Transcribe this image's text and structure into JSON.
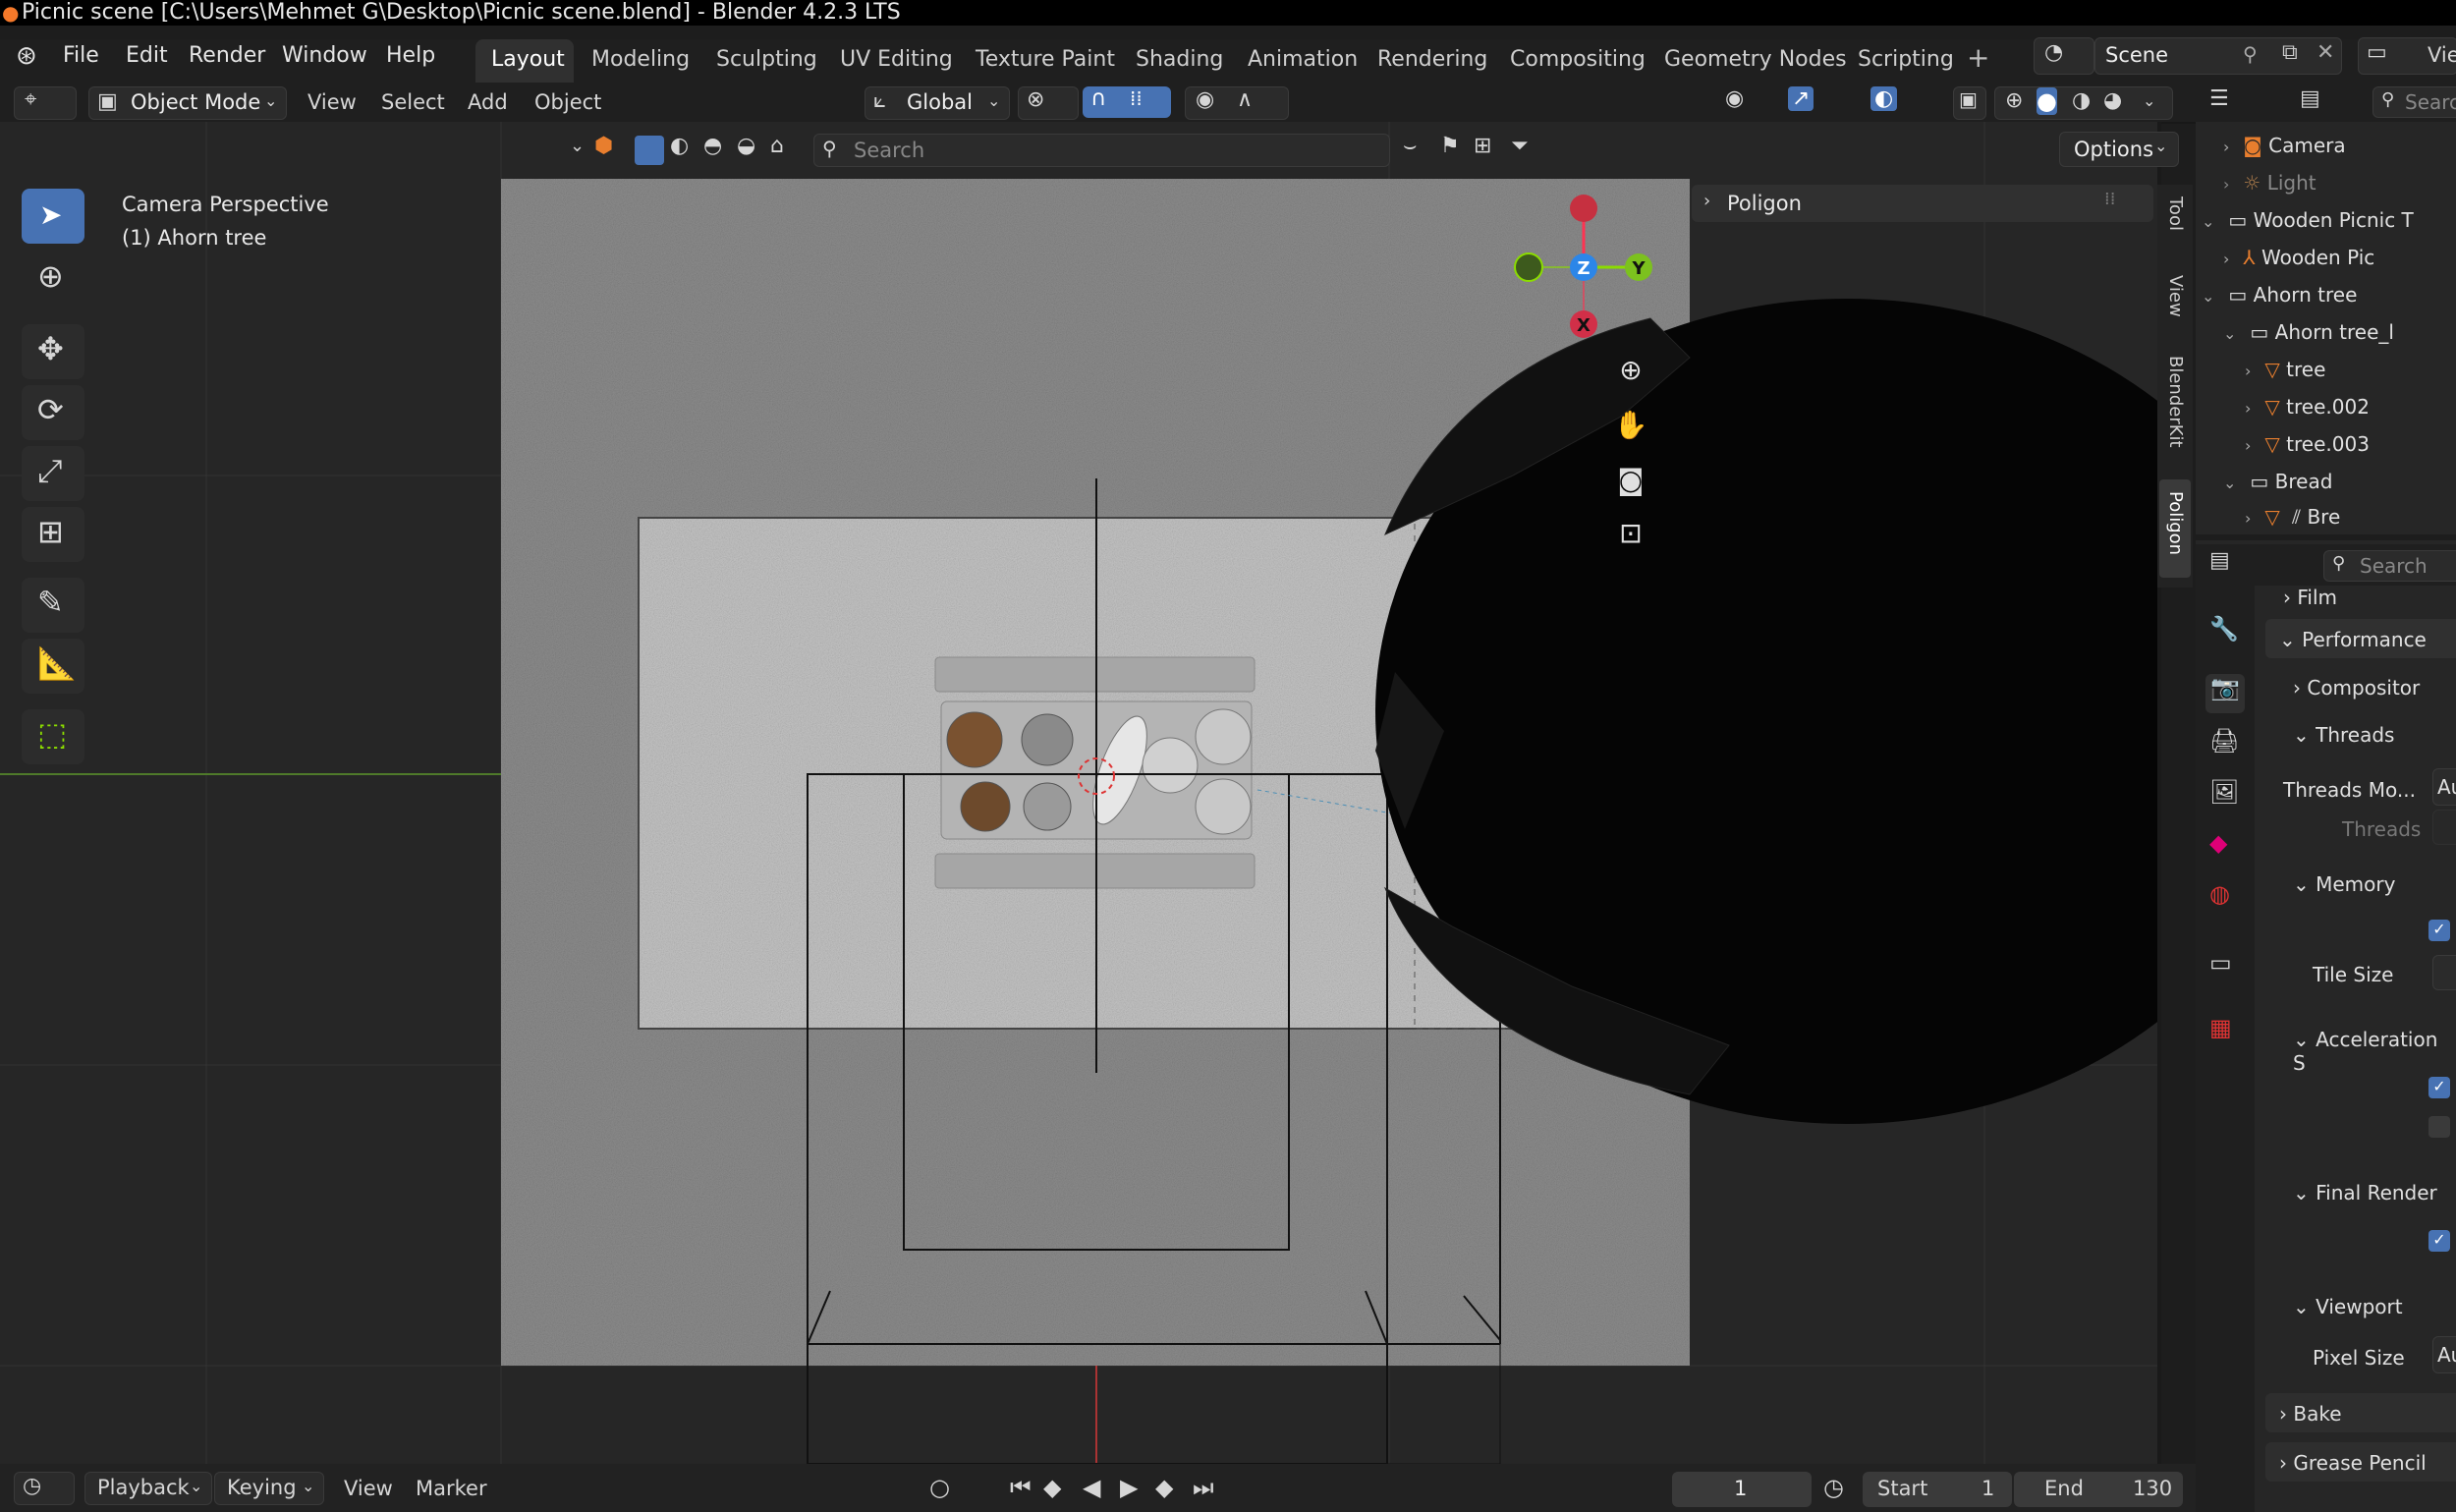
{
  "titlebar": {
    "text": "Picnic scene [C:\\Users\\Mehmet G\\Desktop\\Picnic scene.blend] - Blender 4.2.3 LTS"
  },
  "menu": {
    "file": "File",
    "edit": "Edit",
    "render": "Render",
    "window": "Window",
    "help": "Help"
  },
  "workspaces": [
    "Layout",
    "Modeling",
    "Sculpting",
    "UV Editing",
    "Texture Paint",
    "Shading",
    "Animation",
    "Rendering",
    "Compositing",
    "Geometry Nodes",
    "Scripting"
  ],
  "scene": {
    "name": "Scene",
    "view_layer": "Vie"
  },
  "header": {
    "mode": "Object Mode",
    "view": "View",
    "select": "Select",
    "add": "Add",
    "object": "Object",
    "orientation": "Global",
    "search_placeholder": "Search",
    "options": "Options"
  },
  "viewport": {
    "overlay_line1": "Camera Perspective",
    "overlay_line2": "(1) Ahorn tree",
    "panel_title": "Poligon",
    "axis_x": "X",
    "axis_y": "Y",
    "axis_z": "Z"
  },
  "sidebar_tabs": [
    "Tool",
    "View",
    "BlenderKit",
    "Poligon"
  ],
  "outliner": {
    "items": [
      {
        "label": "Camera"
      },
      {
        "label": "Light"
      },
      {
        "label": "Wooden Picnic T"
      },
      {
        "label": "Wooden Pic"
      },
      {
        "label": "Ahorn tree"
      },
      {
        "label": "Ahorn tree_l"
      },
      {
        "label": "tree"
      },
      {
        "label": "tree.002"
      },
      {
        "label": "tree.003"
      },
      {
        "label": "Bread"
      },
      {
        "label": "Bre"
      }
    ]
  },
  "properties": {
    "search_placeholder": "Search",
    "film": "Film",
    "performance": "Performance",
    "compositor": "Compositor",
    "threads": "Threads",
    "threads_mode_label": "Threads Mo...",
    "threads_mode_value": "Au",
    "threads_label": "Threads",
    "memory": "Memory",
    "tile_size": "Tile Size",
    "acceleration": "Acceleration S",
    "final_render": "Final Render",
    "viewport": "Viewport",
    "pixel_size": "Pixel Size",
    "pixel_size_value": "Au",
    "bake": "Bake",
    "grease_pencil": "Grease Pencil"
  },
  "timeline": {
    "playback": "Playback",
    "keying": "Keying",
    "view": "View",
    "marker": "Marker",
    "current_frame": "1",
    "start_label": "Start",
    "start_value": "1",
    "end_label": "End",
    "end_value": "130"
  },
  "colors": {
    "accent": "#4772b3",
    "x_axis": "#ff3352",
    "y_axis": "#8bdc00",
    "z_axis": "#2890ff"
  }
}
